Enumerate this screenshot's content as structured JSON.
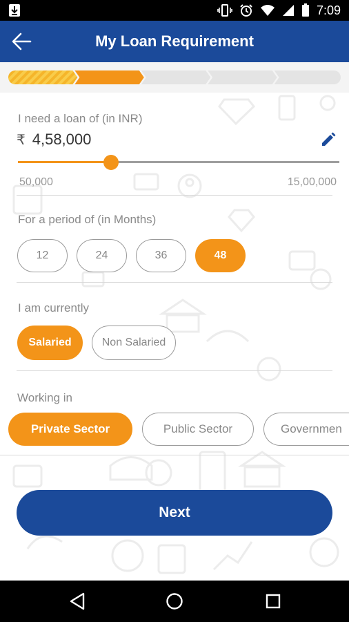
{
  "status_bar": {
    "time": "7:09"
  },
  "app_bar": {
    "title": "My Loan Requirement"
  },
  "progress": {
    "total_steps": 5,
    "completed_steps": 2
  },
  "loan_amount": {
    "label": "I need a loan of (in INR)",
    "currency_symbol": "₹",
    "value": "4,58,000",
    "min_label": "50,000",
    "max_label": "15,00,000",
    "slider_fraction": 0.29
  },
  "period": {
    "label": "For a period of (in Months)",
    "options": [
      "12",
      "24",
      "36",
      "48"
    ],
    "selected": "48"
  },
  "employment": {
    "label": "I am currently",
    "options": [
      "Salaried",
      "Non Salaried"
    ],
    "selected": "Salaried"
  },
  "sector": {
    "label": "Working in",
    "options": [
      "Private Sector",
      "Public Sector",
      "Governmen"
    ],
    "selected": "Private Sector"
  },
  "next_button": {
    "label": "Next"
  },
  "colors": {
    "primary": "#1b4a9a",
    "accent": "#f39419"
  }
}
